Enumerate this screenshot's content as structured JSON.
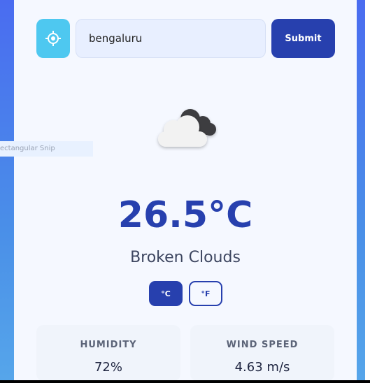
{
  "search": {
    "value": "bengaluru",
    "locate_icon": "crosshair-icon",
    "submit_label": "Submit"
  },
  "overlay": {
    "snip_label": "ectangular Snip"
  },
  "weather": {
    "icon": "broken-clouds-icon",
    "temperature": "26.5°C",
    "description": "Broken Clouds"
  },
  "units": {
    "celsius_label": "°C",
    "fahrenheit_label": "°F",
    "selected": "°C"
  },
  "stats": {
    "humidity_label": "HUMIDITY",
    "humidity_value": "72%",
    "wind_label": "WIND SPEED",
    "wind_value": "4.63 m/s"
  },
  "colors": {
    "accent": "#2740ae",
    "locate_button": "#4ec8f0",
    "background_gradient_top": "#4a6cf0",
    "background_gradient_bottom": "#56a6ea",
    "card": "#f5f8ff"
  }
}
